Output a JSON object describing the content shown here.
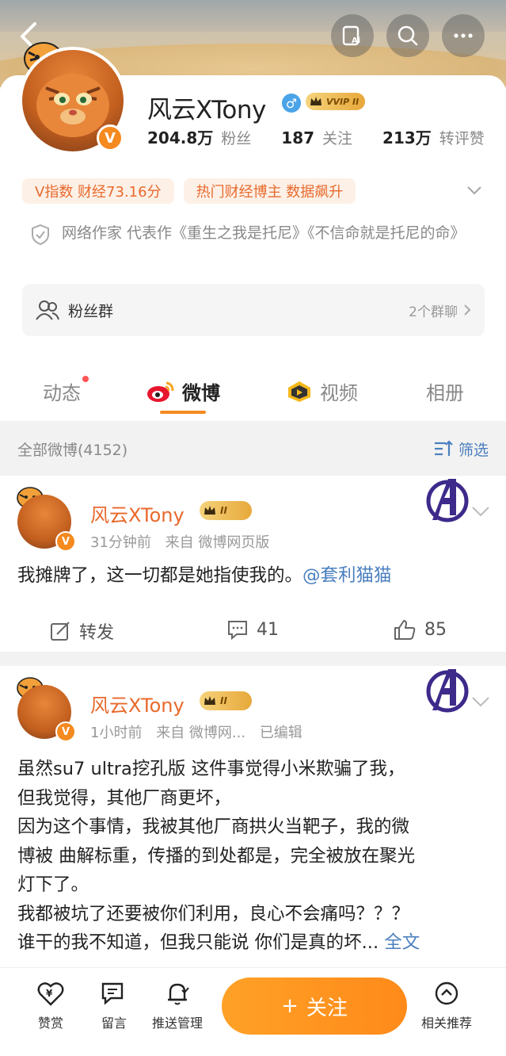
{
  "header": {
    "back_icon": "chevron-left-icon",
    "ai_button_icon": "ai-summary-icon",
    "search_icon": "search-icon",
    "more_icon": "more-icon"
  },
  "profile": {
    "name": "风云XTony",
    "verified_badge": "V",
    "gender_symbol": "♂",
    "vip_label": "VVIP II",
    "stats": [
      {
        "value": "204.8万",
        "label": "粉丝"
      },
      {
        "value": "187",
        "label": "关注"
      },
      {
        "value": "213万",
        "label": "转评赞"
      }
    ],
    "tags": [
      "V指数 财经73.16分",
      "热门财经博主 数据飙升"
    ],
    "description": "网络作家 代表作《重生之我是托尼》《不信命就是托尼的命》",
    "fan_group": {
      "label": "粉丝群",
      "right": "2个群聊"
    }
  },
  "tabs": [
    {
      "label": "动态",
      "has_dot": true
    },
    {
      "label": "微博",
      "active": true
    },
    {
      "label": "视频"
    },
    {
      "label": "相册"
    }
  ],
  "filter": {
    "count_label": "全部微博(4152)",
    "filter_label": "筛选"
  },
  "posts": [
    {
      "author": "风云XTony",
      "badge": "II",
      "time": "31分钟前",
      "source": "来自 微博网页版",
      "edited": "",
      "text": "我摊牌了，这一切都是她指使我的。",
      "mention": "@套利猫猫",
      "repost_label": "转发",
      "comments": "41",
      "likes": "85"
    },
    {
      "author": "风云XTony",
      "badge": "II",
      "time": "1小时前",
      "source": "来自 微博网...",
      "edited": "已编辑",
      "lines": [
        "虽然su7 ultra挖孔版 这件事觉得小米欺骗了我，",
        "但我觉得，其他厂商更坏，",
        "因为这个事情，我被其他厂商拱火当靶子，我的微",
        "博被 曲解标重，传播的到处都是，完全被放在聚光",
        "灯下了。",
        "我都被坑了还要被你们利用，良心不会痛吗？？？",
        "谁干的我不知道，但我只能说 你们是真的坏..."
      ],
      "more_label": "全文"
    }
  ],
  "bottom_bar": {
    "reward": "赞赏",
    "message": "留言",
    "push": "推送管理",
    "follow": "关注",
    "follow_plus": "+",
    "recommend": "相关推荐"
  }
}
